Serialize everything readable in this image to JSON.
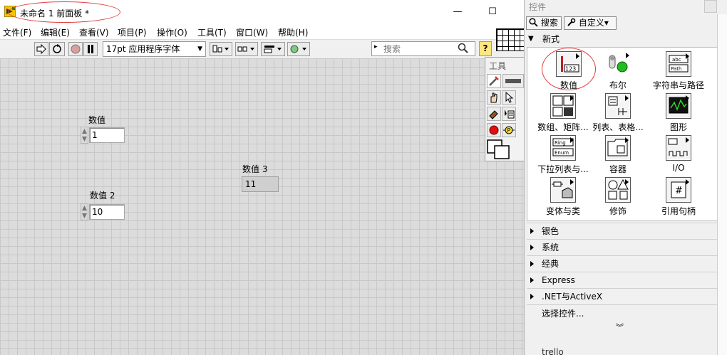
{
  "window": {
    "title": "未命名 1 前面板 *",
    "minimize_glyph": "—",
    "maximize_glyph": "☐"
  },
  "menu": {
    "items": [
      "文件(F)",
      "编辑(E)",
      "查看(V)",
      "项目(P)",
      "操作(O)",
      "工具(T)",
      "窗口(W)",
      "帮助(H)"
    ]
  },
  "toolbar": {
    "font_select_value": "17pt 应用程序字体",
    "search_placeholder": "搜索",
    "help_glyph": "?"
  },
  "front_panel": {
    "controls": [
      {
        "label": "数值",
        "value": "1"
      },
      {
        "label": "数值 2",
        "value": "10"
      }
    ],
    "indicator": {
      "label": "数值 3",
      "value": "11"
    }
  },
  "tools_palette": {
    "title": "工具"
  },
  "controls_palette": {
    "title": "控件",
    "search_button": "搜索",
    "customize_button": "自定义▾",
    "section_new": "新式",
    "items": [
      {
        "label": "数值",
        "icon": "numeric-icon"
      },
      {
        "label": "布尔",
        "icon": "boolean-icon"
      },
      {
        "label": "字符串与路径",
        "icon": "string-path-icon"
      },
      {
        "label": "数组、矩阵...",
        "icon": "array-matrix-icon"
      },
      {
        "label": "列表、表格...",
        "icon": "list-table-icon"
      },
      {
        "label": "图形",
        "icon": "graph-icon"
      },
      {
        "label": "下拉列表与...",
        "icon": "ring-enum-icon"
      },
      {
        "label": "容器",
        "icon": "container-icon"
      },
      {
        "label": "I/O",
        "icon": "io-icon"
      },
      {
        "label": "变体与类",
        "icon": "variant-class-icon"
      },
      {
        "label": "修饰",
        "icon": "decoration-icon"
      },
      {
        "label": "引用句柄",
        "icon": "refnum-icon"
      }
    ],
    "numeric_icon_text": "123",
    "string_icon_text": {
      "top": "abc",
      "bottom": "Path"
    },
    "ring_icon_text": {
      "top": "Ring",
      "bottom": "Enum"
    },
    "refnum_icon_text": "#",
    "sections": [
      "银色",
      "系统",
      "经典",
      "Express",
      ".NET与ActiveX"
    ],
    "select_controls": "选择控件...",
    "more_glyph": "︾"
  },
  "background_window": {
    "partial_text": "trello"
  }
}
